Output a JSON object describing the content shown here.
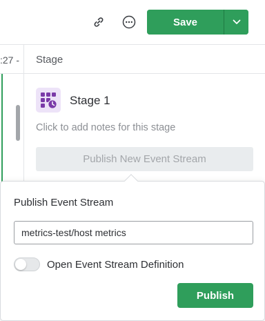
{
  "toolbar": {
    "save_label": "Save",
    "icons": {
      "link": "link-icon",
      "more": "more-horizontal-icon",
      "caret": "chevron-down-icon"
    }
  },
  "grid": {
    "time_label": ":27 - ",
    "column_header": "Stage"
  },
  "stage": {
    "title": "Stage 1",
    "notes_placeholder": "Click to add notes for this stage",
    "publish_new_label": "Publish New Event Stream",
    "icon": "stage-grid-clock-icon"
  },
  "popover": {
    "title": "Publish Event Stream",
    "input_value": "metrics-test/host metrics",
    "toggle_label": "Open Event Stream Definition",
    "toggle_on": false,
    "publish_label": "Publish"
  },
  "colors": {
    "accent_green": "#2f9e5b",
    "stage_icon_bg": "#ede3f8",
    "stage_icon_fg": "#7a3aa8"
  }
}
